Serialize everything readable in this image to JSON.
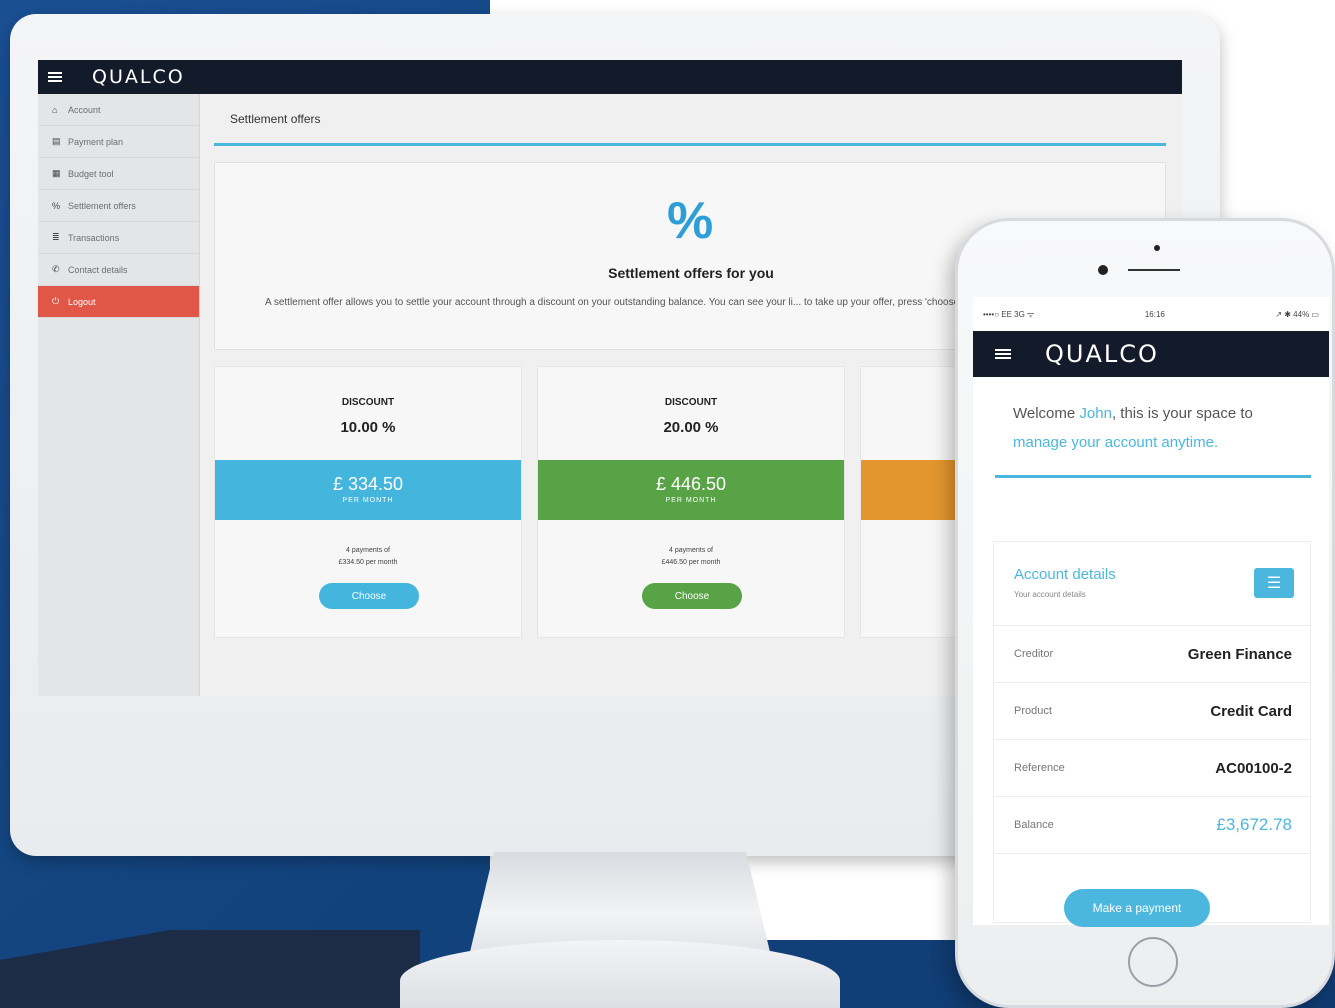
{
  "desktop": {
    "brand": "QUALCO",
    "sidebar": {
      "items": [
        {
          "label": "Account",
          "icon": "home-icon",
          "glyph": "⌂"
        },
        {
          "label": "Payment plan",
          "icon": "calendar-icon",
          "glyph": "▤"
        },
        {
          "label": "Budget tool",
          "icon": "calculator-icon",
          "glyph": "▦"
        },
        {
          "label": "Settlement offers",
          "icon": "percent-icon",
          "glyph": "%"
        },
        {
          "label": "Transactions",
          "icon": "list-icon",
          "glyph": "≣"
        },
        {
          "label": "Contact details",
          "icon": "phone-icon",
          "glyph": "✆"
        },
        {
          "label": "Logout",
          "icon": "power-icon",
          "glyph": "⏻"
        }
      ]
    },
    "page_title": "Settlement offers",
    "intro": {
      "icon": "%",
      "heading": "Settlement offers for you",
      "text": "A settlement offer allows you to settle your account through a discount on your outstanding balance. You can see your li... to take up your offer, press 'choose' below and see the options available."
    },
    "offers": [
      {
        "label": "DISCOUNT",
        "percent": "10.00 %",
        "amount": "£ 334.50",
        "amount_sub": "PER MONTH",
        "note_line1": "4 payments of",
        "note_line2": "£334.50 per month",
        "button": "Choose",
        "color": "#44b6de"
      },
      {
        "label": "DISCOUNT",
        "percent": "20.00 %",
        "amount": "£ 446.50",
        "amount_sub": "PER MONTH",
        "note_line1": "4 payments of",
        "note_line2": "£446.50 per month",
        "button": "Choose",
        "color": "#58a345"
      },
      {
        "label": "",
        "percent": "",
        "amount": "",
        "amount_sub": "",
        "note_line1": "",
        "note_line2": "",
        "button": "",
        "color": "#e4962e"
      }
    ]
  },
  "mobile": {
    "status": {
      "left": "••••○ EE 3G ᯤ",
      "time": "16:16",
      "right": "↗ ✱ 44% ▭"
    },
    "brand": "QUALCO",
    "welcome": {
      "pre": "Welcome ",
      "name": "John",
      "mid": ", this is your space to ",
      "link": "manage your account",
      "post": " anytime."
    },
    "account": {
      "title": "Account details",
      "subtitle": "Your account details",
      "rows": [
        {
          "label": "Creditor",
          "value": "Green Finance"
        },
        {
          "label": "Product",
          "value": "Credit Card"
        },
        {
          "label": "Reference",
          "value": "AC00100-2"
        },
        {
          "label": "Balance",
          "value": "£3,672.78"
        }
      ]
    },
    "pay_button": "Make a payment"
  },
  "colors": {
    "accent": "#4bb7de",
    "nav_dark": "#131a2a",
    "active_sidebar": "#e05647",
    "green": "#58a345",
    "orange": "#e4962e"
  }
}
